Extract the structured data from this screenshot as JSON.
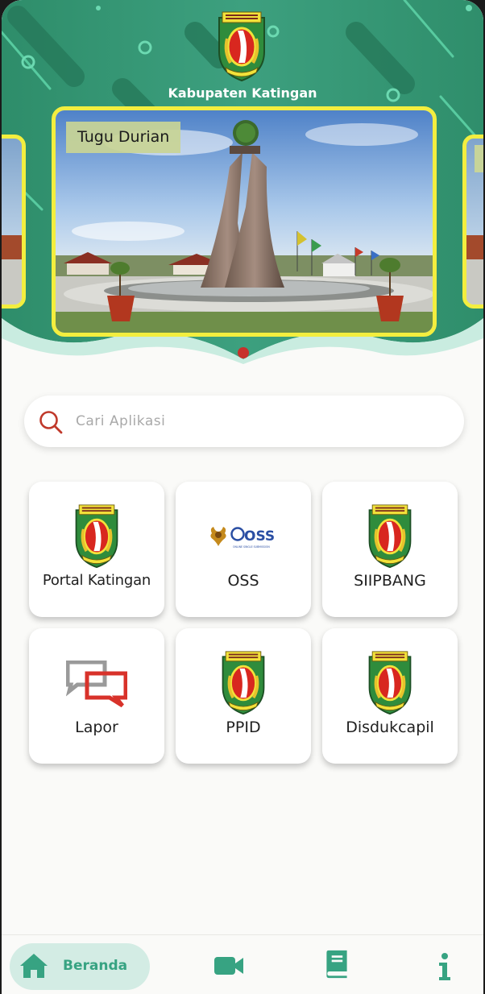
{
  "header": {
    "title": "Kabupaten Katingan",
    "logo_icon": "katingan-emblem-icon",
    "accent_color": "#35a084",
    "slider": {
      "current_caption": "Tugu Durian",
      "frame_color": "#f3ee3f",
      "active_indicator_color": "#c7312b"
    }
  },
  "search": {
    "placeholder": "Cari Aplikasi",
    "value": "",
    "icon": "search-icon"
  },
  "apps": [
    {
      "label": "Portal Katingan",
      "icon": "katingan-emblem-icon"
    },
    {
      "label": "OSS",
      "icon": "oss-logo-icon"
    },
    {
      "label": "SIIPBANG",
      "icon": "katingan-emblem-icon"
    },
    {
      "label": "Lapor",
      "icon": "chat-bubbles-icon"
    },
    {
      "label": "PPID",
      "icon": "katingan-emblem-icon"
    },
    {
      "label": "Disdukcapil",
      "icon": "katingan-emblem-icon"
    }
  ],
  "oss_logo": {
    "text": "OSS",
    "tagline": "ONLINE SINGLE SUBMISSION"
  },
  "bottom_nav": {
    "active": "Beranda",
    "items": [
      {
        "label": "Beranda",
        "icon": "home-icon"
      },
      {
        "icon": "video-camera-icon"
      },
      {
        "icon": "book-icon"
      },
      {
        "icon": "info-icon"
      }
    ]
  }
}
